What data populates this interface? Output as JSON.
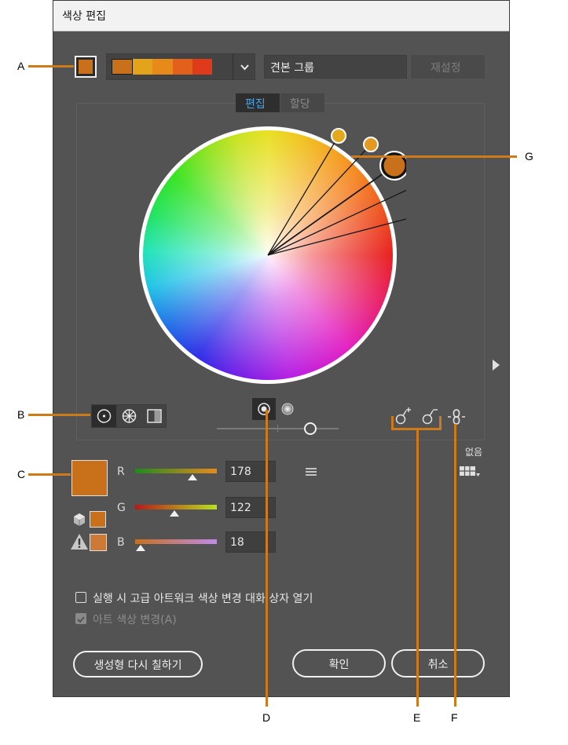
{
  "window": {
    "title": "색상 편집"
  },
  "top_bar": {
    "base_color": "#c8701a",
    "group_colors": [
      "#c8701a",
      "#e3a31a",
      "#e68a1a",
      "#e2601a",
      "#df3a1a"
    ],
    "group_name": "견본 그룹",
    "reset_label": "재설정"
  },
  "tabs": [
    {
      "label": "편집",
      "active": true
    },
    {
      "label": "할당",
      "active": false
    }
  ],
  "wheel": {
    "handles": [
      {
        "color": "#e4a81c"
      },
      {
        "color": "#e49a22"
      },
      {
        "color": "#c8701a",
        "selected": true
      },
      {
        "color": "#e25718"
      },
      {
        "color": "#de3a1a"
      }
    ]
  },
  "wheel_modes": [
    {
      "name": "smooth-wheel",
      "icon": "circle-dot-icon",
      "selected": true
    },
    {
      "name": "segmented-wheel",
      "icon": "segmented-wheel-icon",
      "selected": false
    },
    {
      "name": "color-bars",
      "icon": "color-bars-icon",
      "selected": false
    }
  ],
  "display_toggle": [
    {
      "name": "show-saturation",
      "icon": "saturation-icon",
      "selected": true
    },
    {
      "name": "show-brightness",
      "icon": "brightness-icon",
      "selected": false
    }
  ],
  "brightness_slider": {
    "level": 0.76
  },
  "tools": {
    "add_color": "add-color-tool-icon",
    "remove_color": "remove-color-tool-icon",
    "link": "link-harmony-icon"
  },
  "limit": {
    "label": "없음"
  },
  "current_color": "#c8701a",
  "sliders": [
    {
      "label": "R",
      "value": "178",
      "fraction": 0.7,
      "gradient": [
        "#1f8a1f",
        "#e88a1a"
      ]
    },
    {
      "label": "G",
      "value": "122",
      "fraction": 0.48,
      "gradient": [
        "#b81818",
        "#b8e21a"
      ]
    },
    {
      "label": "B",
      "value": "18",
      "fraction": 0.07,
      "gradient": [
        "#c8701a",
        "#c08ae8"
      ]
    }
  ],
  "options": {
    "checkbox1": {
      "label": "실행 시 고급 아트워크 색상 변경 대화 상자 열기",
      "checked": false
    },
    "checkbox2": {
      "label": "아트 색상 변경(A)",
      "checked": true,
      "disabled": true
    }
  },
  "buttons": {
    "regen": "생성형 다시 칠하기",
    "ok": "확인",
    "cancel": "취소"
  },
  "callouts": [
    "A",
    "B",
    "C",
    "D",
    "E",
    "F",
    "G"
  ],
  "colors": {
    "callout": "#cf7a1a",
    "active_tab": "#4aa3e8"
  }
}
